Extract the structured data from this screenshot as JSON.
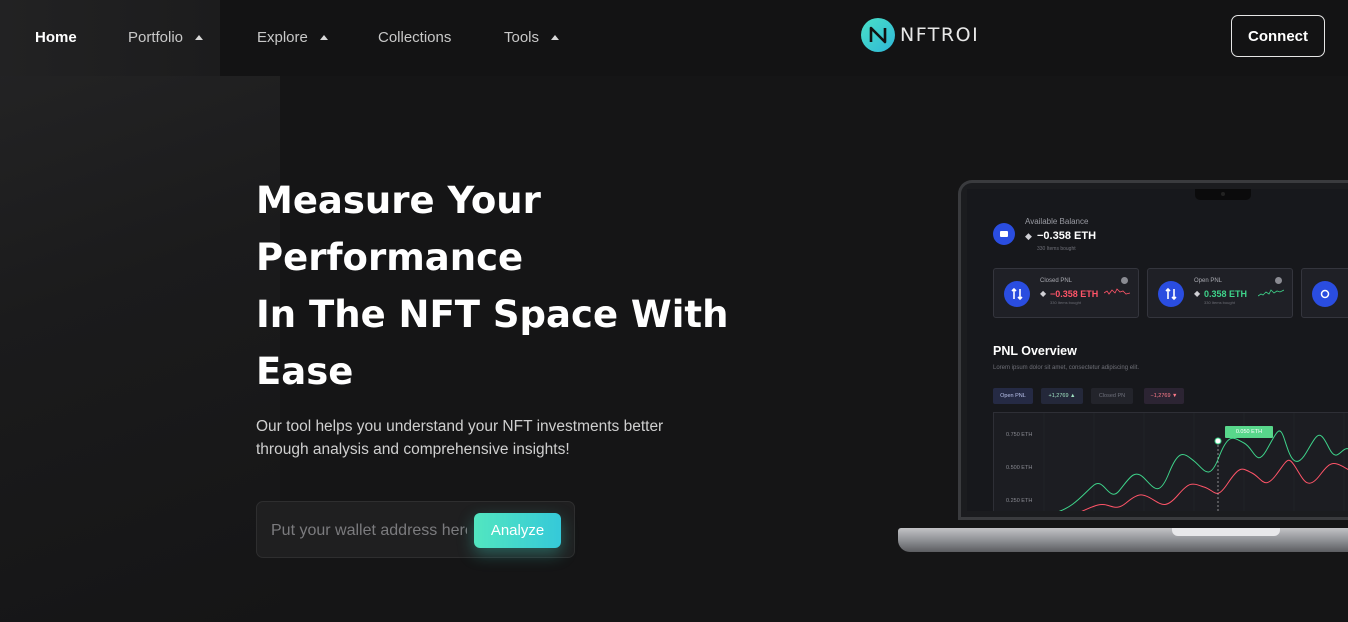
{
  "nav": {
    "items": [
      {
        "label": "Home",
        "active": true
      },
      {
        "label": "Portfolio",
        "dropdown": true
      },
      {
        "label": "Explore",
        "dropdown": true
      },
      {
        "label": "Collections"
      },
      {
        "label": "Tools",
        "dropdown": true
      }
    ],
    "logo_text": "NFTROI",
    "connect_label": "Connect"
  },
  "hero": {
    "title_lines": [
      "Measure Your",
      "Performance",
      "In The NFT Space With",
      "Ease"
    ],
    "subtitle_lines": [
      "Our tool helps you understand your NFT investments better",
      "through analysis and comprehensive insights!"
    ],
    "search_placeholder": "Put your wallet address here",
    "analyze_label": "Analyze"
  },
  "dashboard": {
    "balance_label": "Available Balance",
    "balance_value": "−0.358 ETH",
    "balance_sub": "330 Items bought",
    "cards": [
      {
        "label": "Closed PNL",
        "value": "−0.358 ETH",
        "sub": "330 Items bought",
        "trend": "down"
      },
      {
        "label": "Open PNL",
        "value": "0.358 ETH",
        "sub": "330 Items bought",
        "trend": "up"
      }
    ],
    "pnl_title": "PNL Overview",
    "pnl_desc": "Lorem ipsum dolor sit amet, consectetur adipiscing elit.",
    "pills": [
      {
        "label": "Open PNL"
      },
      {
        "label": "+1,2769 ▲"
      },
      {
        "label": "Closed PN"
      },
      {
        "label": "−1,2769 ▼"
      }
    ],
    "y_labels": [
      "0.750 ETH",
      "0.500 ETH",
      "0.250 ETH"
    ],
    "tooltip": "0.050 ETH",
    "colors": {
      "accent": "#52e6c0",
      "up": "#3ed38a",
      "down": "#ff5468",
      "icon_blue": "#2a4de0"
    }
  }
}
